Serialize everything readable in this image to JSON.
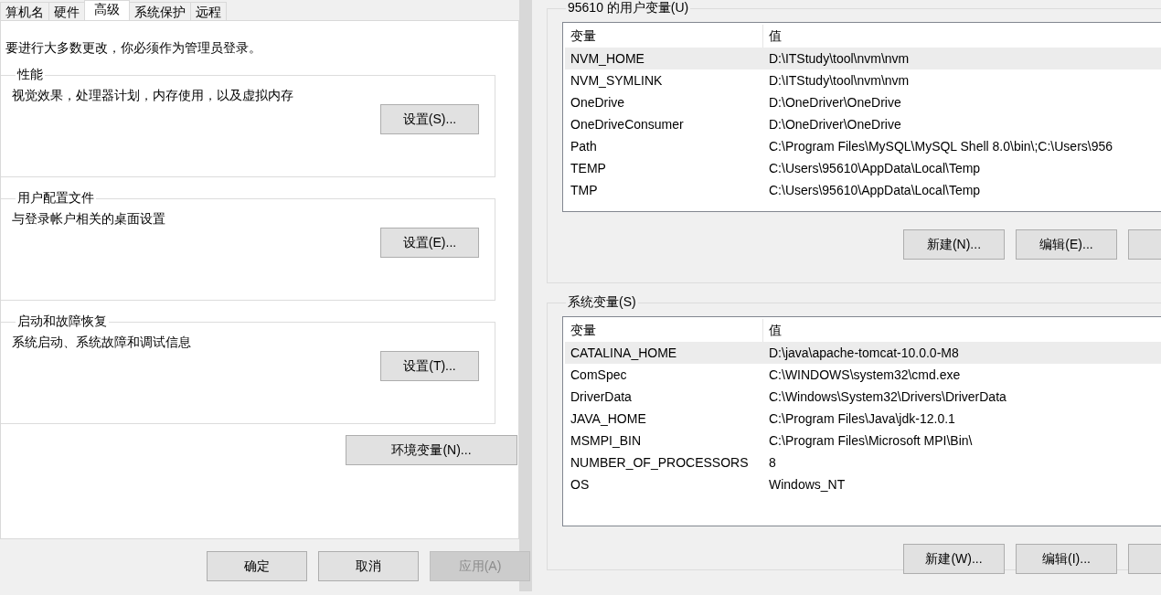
{
  "system_properties": {
    "tabs": [
      {
        "label": "算机名",
        "selected": false
      },
      {
        "label": "硬件",
        "selected": false
      },
      {
        "label": "高级",
        "selected": true
      },
      {
        "label": "系统保护",
        "selected": false
      },
      {
        "label": "远程",
        "selected": false
      }
    ],
    "notice": "要进行大多数更改，你必须作为管理员登录。",
    "groups": [
      {
        "title": "性能",
        "description": "视觉效果，处理器计划，内存使用，以及虚拟内存",
        "button": "设置(S)..."
      },
      {
        "title": "用户配置文件",
        "description": "与登录帐户相关的桌面设置",
        "button": "设置(E)..."
      },
      {
        "title": "启动和故障恢复",
        "description": "系统启动、系统故障和调试信息",
        "button": "设置(T)..."
      }
    ],
    "env_button": "环境变量(N)...",
    "footer_buttons": [
      {
        "label": "确定",
        "disabled": false
      },
      {
        "label": "取消",
        "disabled": false
      },
      {
        "label": "应用(A)",
        "disabled": true
      }
    ]
  },
  "environment_variables": {
    "sections": [
      {
        "title": "95610 的用户变量(U)",
        "columns": [
          "变量",
          "值"
        ],
        "rows": [
          {
            "name": "NVM_HOME",
            "value": "D:\\ITStudy\\tool\\nvm\\nvm",
            "selected": true
          },
          {
            "name": "NVM_SYMLINK",
            "value": "D:\\ITStudy\\tool\\nvm\\nvm",
            "selected": false
          },
          {
            "name": "OneDrive",
            "value": "D:\\OneDriver\\OneDrive",
            "selected": false
          },
          {
            "name": "OneDriveConsumer",
            "value": "D:\\OneDriver\\OneDrive",
            "selected": false
          },
          {
            "name": "Path",
            "value": "C:\\Program Files\\MySQL\\MySQL Shell 8.0\\bin\\;C:\\Users\\956",
            "selected": false
          },
          {
            "name": "TEMP",
            "value": "C:\\Users\\95610\\AppData\\Local\\Temp",
            "selected": false
          },
          {
            "name": "TMP",
            "value": "C:\\Users\\95610\\AppData\\Local\\Temp",
            "selected": false
          }
        ],
        "buttons": [
          "新建(N)...",
          "编辑(E)..."
        ]
      },
      {
        "title": "系统变量(S)",
        "columns": [
          "变量",
          "值"
        ],
        "rows": [
          {
            "name": "CATALINA_HOME",
            "value": "D:\\java\\apache-tomcat-10.0.0-M8",
            "selected": true
          },
          {
            "name": "ComSpec",
            "value": "C:\\WINDOWS\\system32\\cmd.exe",
            "selected": false
          },
          {
            "name": "DriverData",
            "value": "C:\\Windows\\System32\\Drivers\\DriverData",
            "selected": false
          },
          {
            "name": "JAVA_HOME",
            "value": "C:\\Program Files\\Java\\jdk-12.0.1",
            "selected": false
          },
          {
            "name": "MSMPI_BIN",
            "value": "C:\\Program Files\\Microsoft MPI\\Bin\\",
            "selected": false
          },
          {
            "name": "NUMBER_OF_PROCESSORS",
            "value": "8",
            "selected": false
          },
          {
            "name": "OS",
            "value": "Windows_NT",
            "selected": false
          }
        ],
        "buttons": [
          "新建(W)...",
          "编辑(I)..."
        ]
      }
    ]
  }
}
